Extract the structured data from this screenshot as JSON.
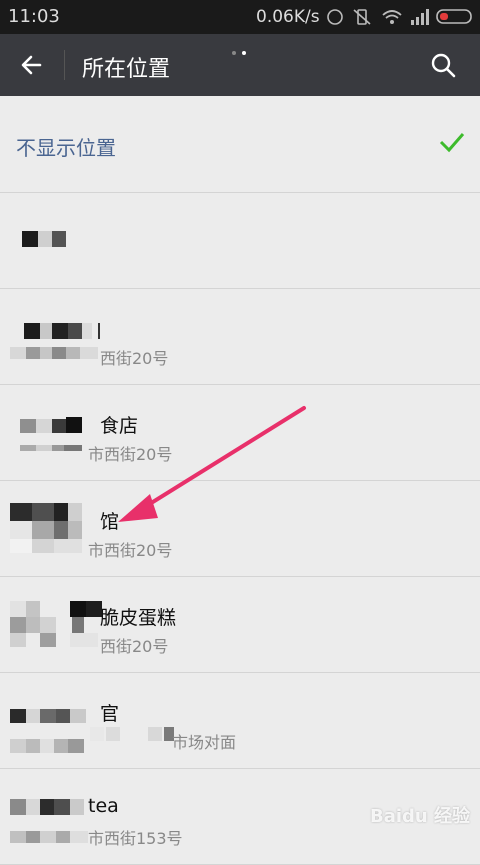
{
  "status": {
    "time": "11:03",
    "speed": "0.06K/s"
  },
  "header": {
    "title": "所在位置"
  },
  "none_option": {
    "label": "不显示位置"
  },
  "locations": [
    {
      "name": "",
      "address": ""
    },
    {
      "name": "",
      "address": "西街20号"
    },
    {
      "name": "食店",
      "address": "市西街20号"
    },
    {
      "name": "馆",
      "address": "市西街20号"
    },
    {
      "name": "脆皮蛋糕",
      "address": "西街20号"
    },
    {
      "name": "官",
      "address": "市场对面"
    },
    {
      "name": "tea",
      "address": "市西街153号"
    }
  ],
  "watermark": "Baidu 经验",
  "colors": {
    "option_text": "#4a6591",
    "check": "#3dbb2c",
    "arrow": "#e8306a",
    "appbar": "#393a3f"
  }
}
